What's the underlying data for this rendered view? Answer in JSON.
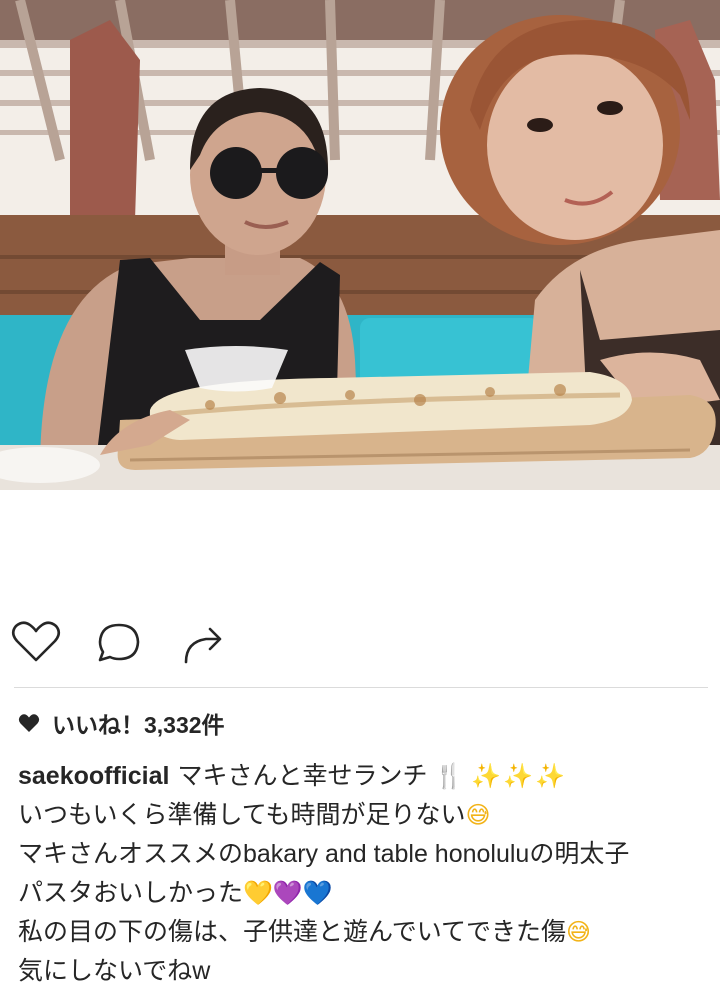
{
  "post": {
    "likes_text": "いいね！3,332件",
    "username": "saekoofficial",
    "caption_lines": [
      "マキさんと幸せランチ",
      "いつもいくら準備しても時間が足りない",
      "マキさんオススメのbakary and table honoluluの明太子",
      "パスタおいしかった",
      "私の目の下の傷は、子供達と遊んでいてできた傷",
      "気にしないでねw"
    ]
  },
  "actions": {
    "like_icon": "heart-outline-icon",
    "comment_icon": "comment-bubble-icon",
    "share_icon": "share-arrow-icon"
  },
  "emoji": {
    "fork_knife": "🍴",
    "sparkles": "✨✨✨",
    "sweat_smile": "😅",
    "yellow_heart": "💛",
    "purple_heart": "💜",
    "blue_heart": "💙"
  },
  "colors": {
    "text": "#262626",
    "divider": "#dbdbdb",
    "icon": "#262626"
  }
}
